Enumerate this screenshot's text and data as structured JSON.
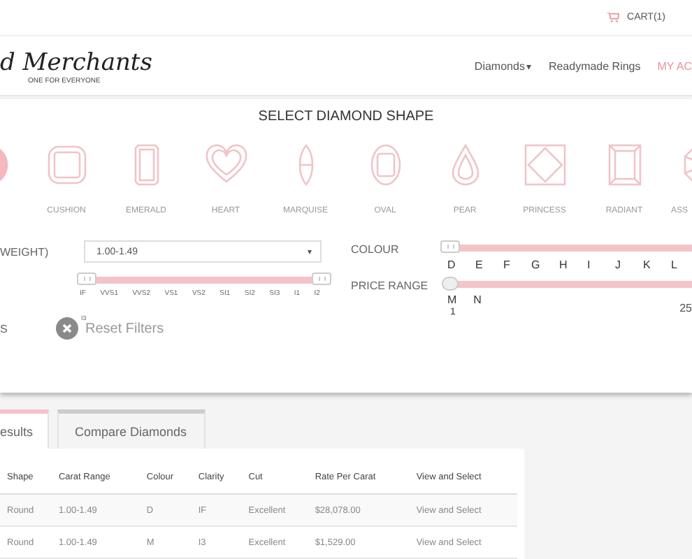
{
  "top_bar": {
    "cart": "CART(1)"
  },
  "header": {
    "logo": "d Merchants",
    "tagline": "ONE FOR EVERYONE",
    "nav": [
      {
        "label": "Diamonds",
        "caret": "▾",
        "highlight": false
      },
      {
        "label": "Readymade Rings",
        "highlight": false
      },
      {
        "label": "MY AC",
        "highlight": true
      }
    ]
  },
  "shape_panel": {
    "title": "SELECT DIAMOND SHAPE",
    "shapes": [
      {
        "kind": "round",
        "selected": true
      },
      {
        "kind": "cushion",
        "label": "CUSHION",
        "selected": false
      },
      {
        "kind": "emerald",
        "label": "EMERALD",
        "selected": false
      },
      {
        "kind": "heart",
        "label": "HEART",
        "selected": false
      },
      {
        "kind": "marquise",
        "label": "MARQUISE",
        "selected": false
      },
      {
        "kind": "oval",
        "label": "OVAL",
        "selected": false
      },
      {
        "kind": "pear",
        "label": "PEAR",
        "selected": false
      },
      {
        "kind": "princess",
        "label": "PRINCESS",
        "selected": false
      },
      {
        "kind": "radiant",
        "label": "RADIANT",
        "selected": false
      },
      {
        "kind": "asscher",
        "label": "ASS",
        "selected": false
      }
    ]
  },
  "filters": {
    "weight_label": "WEIGHT)",
    "weight_select": "1.00-1.49",
    "select_arrow": "▾",
    "clarity": {
      "level": 1,
      "labels": [
        "IF",
        "VVS1",
        "VVS2",
        "VS1",
        "VS2",
        "SI1",
        "SI2",
        "SI3",
        "I1",
        "I2"
      ],
      "overflow_label": "I3"
    },
    "cut_label": "S",
    "reset": "Reset Filters",
    "colour": {
      "label": "COLOUR",
      "level": 1,
      "labels": [
        "D",
        "E",
        "F",
        "G",
        "H",
        "I",
        "J",
        "K",
        "L"
      ],
      "wrapped_labels": [
        "M",
        "N"
      ]
    },
    "price": {
      "label": "PRICE RANGE",
      "level": 1,
      "min": "1",
      "max": "25"
    }
  },
  "tabs": [
    {
      "label": "esults",
      "selected": true
    },
    {
      "label": "Compare Diamonds",
      "selected": false
    }
  ],
  "table": {
    "columns": [
      "Shape",
      "Carat Range",
      "Colour",
      "Clarity",
      "Cut",
      "Rate Per Carat",
      "View and Select"
    ],
    "rows": [
      [
        "Round",
        "1.00-1.49",
        "D",
        "IF",
        "Excellent",
        "$28,078.00",
        "View and Select"
      ],
      [
        "Round",
        "1.00-1.49",
        "M",
        "I3",
        "Excellent",
        "$1,529.00",
        "View and Select"
      ]
    ]
  }
}
